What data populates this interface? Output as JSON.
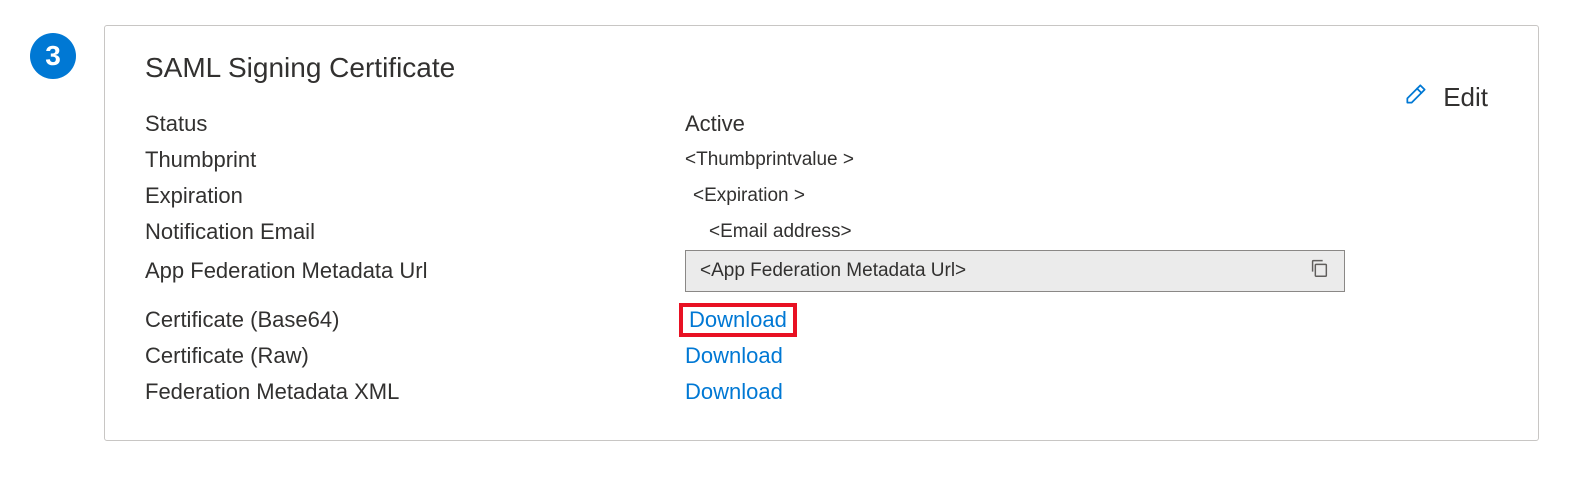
{
  "step": {
    "number": "3"
  },
  "card": {
    "title": "SAML Signing Certificate",
    "edit_label": "Edit",
    "fields": {
      "status_label": "Status",
      "status_value": "Active",
      "thumbprint_label": "Thumbprint",
      "thumbprint_value": "<Thumbprintvalue >",
      "expiration_label": "Expiration",
      "expiration_value": "<Expiration >",
      "notification_email_label": "Notification Email",
      "notification_email_value": "<Email address>",
      "metadata_url_label": "App Federation Metadata Url",
      "metadata_url_value": "<App Federation Metadata Url>",
      "cert_base64_label": "Certificate (Base64)",
      "cert_base64_action": "Download",
      "cert_raw_label": "Certificate (Raw)",
      "cert_raw_action": "Download",
      "fed_xml_label": "Federation Metadata XML",
      "fed_xml_action": "Download"
    }
  }
}
